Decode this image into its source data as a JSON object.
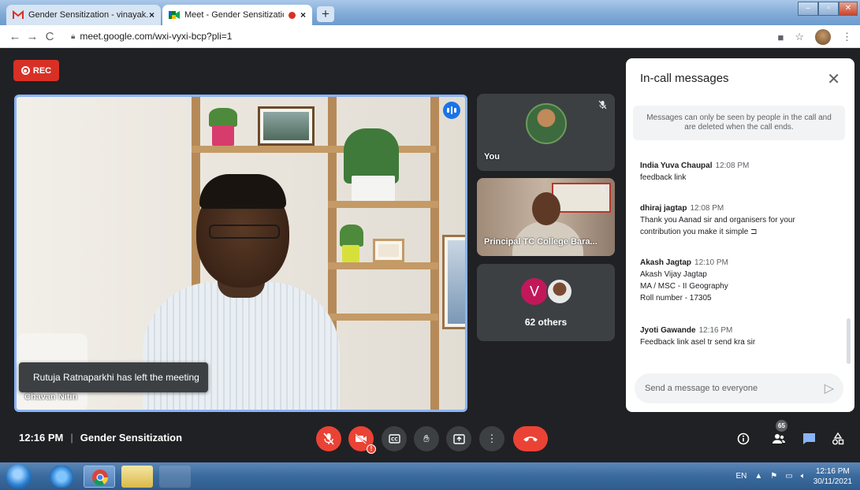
{
  "browser": {
    "tabs": [
      {
        "title": "Gender Sensitization - vinayak.la",
        "close": "×"
      },
      {
        "title": "Meet - Gender Sensitization",
        "close": "×"
      }
    ],
    "new_tab": "+",
    "url": "meet.google.com/wxi-vyxi-bcp?pli=1"
  },
  "meet": {
    "rec_label": "REC",
    "main_participant": "Chavan Nitin",
    "toast": "Rutuja Ratnaparkhi has left the meeting",
    "tiles": {
      "you_label": "You",
      "principal_label": "Principal TC College Bara...",
      "others_avatar_letter": "V",
      "others_label": "62 others"
    },
    "bottom": {
      "time": "12:16 PM",
      "meeting_name": "Gender Sensitization",
      "participants_count": "65"
    }
  },
  "chat": {
    "title": "In-call messages",
    "note": "Messages can only be seen by people in the call and are deleted when the call ends.",
    "messages": [
      {
        "sender": "India Yuva Chaupal",
        "time": "12:08 PM",
        "lines": [
          "feedback link"
        ]
      },
      {
        "sender": "dhiraj jagtap",
        "time": "12:08 PM",
        "lines": [
          "Thank you Aanad sir and organisers for your",
          "contribution you make it simple ⊐"
        ]
      },
      {
        "sender": "Akash Jagtap",
        "time": "12:10 PM",
        "lines": [
          "Akash Vijay Jagtap",
          "MA / MSC - II Geography",
          "Roll number - 17305"
        ]
      },
      {
        "sender": "Jyoti Gawande",
        "time": "12:16 PM",
        "lines": [
          "Feedback link asel tr send kra sir"
        ]
      }
    ],
    "input_placeholder": "Send a message to everyone"
  },
  "taskbar": {
    "lang": "EN",
    "time": "12:16 PM",
    "date": "30/11/2021"
  },
  "colors": {
    "accent_blue": "#1a73e8",
    "danger_red": "#ea4335",
    "meet_bg": "#202124"
  }
}
